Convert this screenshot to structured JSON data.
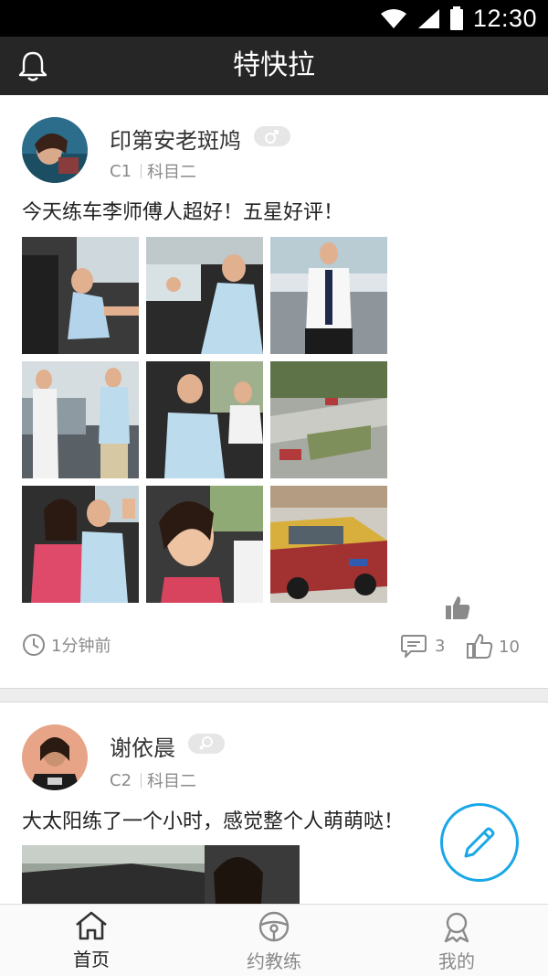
{
  "status_bar": {
    "time": "12:30",
    "icons": [
      "wifi-icon",
      "signal-icon",
      "battery-icon"
    ]
  },
  "app_bar": {
    "title": "特快拉",
    "left_icon": "bell-icon"
  },
  "posts": [
    {
      "user": "印第安老斑鸠",
      "gender": "male",
      "license": "C1",
      "subject": "科目二",
      "text": "今天练车李师傅人超好！五星好评！",
      "time_ago": "1分钟前",
      "comments": "3",
      "likes": "10",
      "photos": [
        "photo-car-interior",
        "photo-thumbs-up",
        "photo-man-standing",
        "photo-two-men-car",
        "photo-passenger",
        "photo-training-ground",
        "photo-couple-wave",
        "photo-woman-smile",
        "photo-taxi"
      ]
    },
    {
      "user": "谢依晨",
      "gender": "female",
      "license": "C2",
      "subject": "科目二",
      "text": "大太阳练了一个小时，感觉整个人萌萌哒！"
    }
  ],
  "tabs": [
    {
      "label": "首页",
      "icon": "home-icon",
      "active": true
    },
    {
      "label": "约教练",
      "icon": "steering-wheel-icon",
      "active": false
    },
    {
      "label": "我的",
      "icon": "user-icon",
      "active": false
    }
  ],
  "colors": {
    "app_bar": "#262626",
    "accent": "#1aa7e8",
    "divider": "#ededed",
    "muted_text": "#8a8a8a"
  }
}
